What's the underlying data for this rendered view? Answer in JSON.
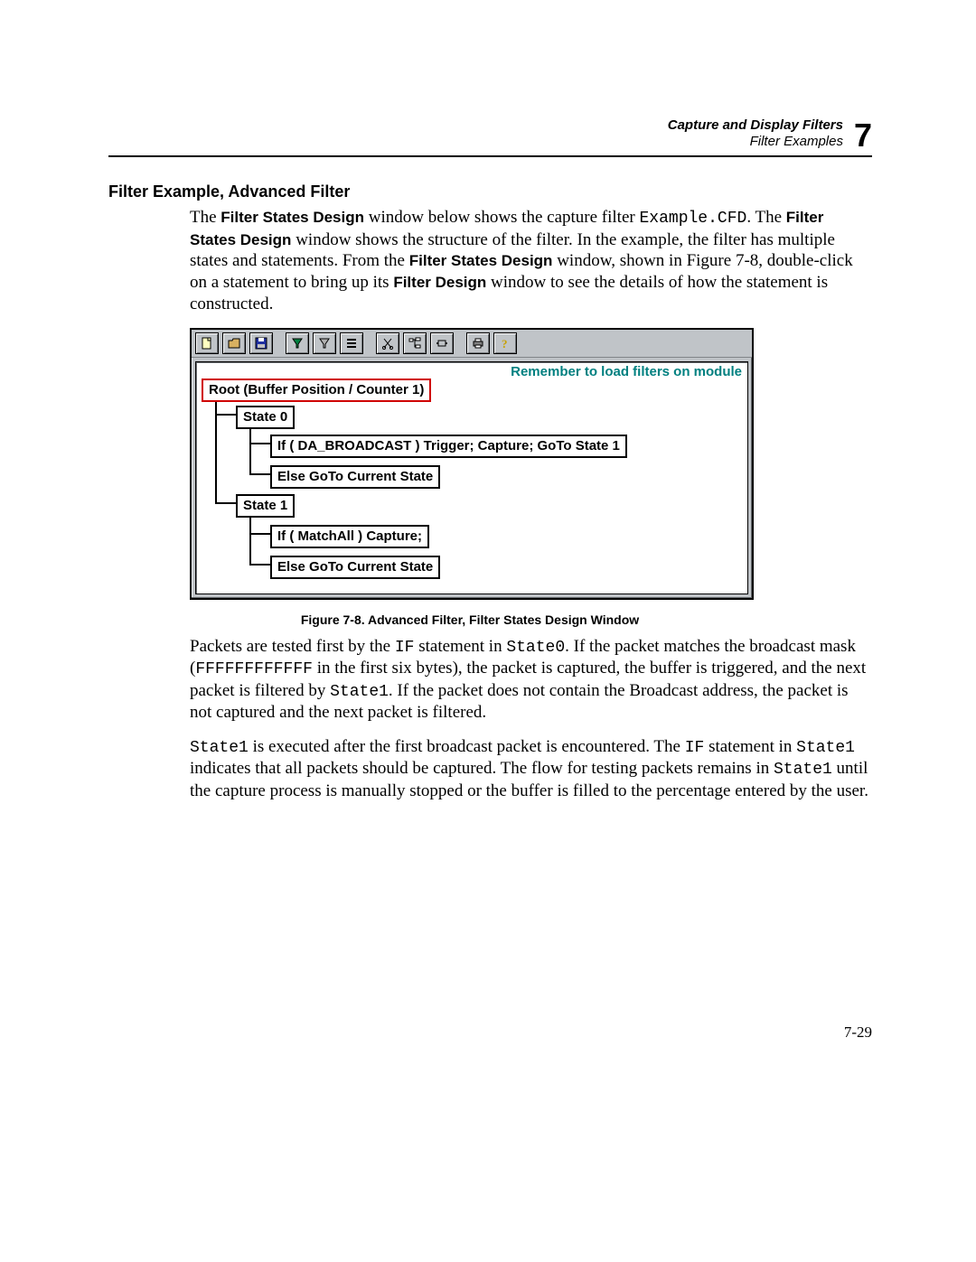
{
  "header": {
    "title": "Capture and Display Filters",
    "subtitle": "Filter Examples",
    "chapter": "7"
  },
  "section_heading": "Filter Example, Advanced Filter",
  "intro": {
    "pre1": "The ",
    "fsd1": "Filter States Design",
    "mid1": " window below shows the capture filter ",
    "code1": "Example.CFD",
    "post1": ". The ",
    "fsd2": "Filter States Design",
    "mid2": " window shows the structure of the filter. In the example, the filter has multiple states and statements. From the ",
    "fsd3": "Filter States Design",
    "mid3": " window, shown in Figure 7-8, double-click on a statement to bring up its ",
    "fd": "Filter Design",
    "post3": " window to see the details of how the statement is constructed."
  },
  "figure": {
    "reminder": "Remember to load filters on module",
    "root": "Root (Buffer Position / Counter 1)",
    "state0": "State 0",
    "s0_if": "If ( DA_BROADCAST )  Trigger;  Capture; GoTo State 1",
    "s0_else": "Else GoTo Current State",
    "state1": "State 1",
    "s1_if": "If ( MatchAll )  Capture;",
    "s1_else": "Else GoTo Current State",
    "caption": "Figure 7-8. Advanced Filter, Filter States Design Window"
  },
  "para2": {
    "t1": "Packets are tested first by the ",
    "c1": "IF",
    "t2": " statement in ",
    "c2": "State0",
    "t3": ". If the packet matches the broadcast mask (",
    "c3": "FFFFFFFFFFFF",
    "t4": " in the first six bytes), the packet is captured, the buffer is triggered, and the next packet is filtered by ",
    "c4": "State1",
    "t5": ". If the packet does not contain the Broadcast address, the packet is not captured and the next packet is filtered."
  },
  "para3": {
    "c1": "State1",
    "t1": " is executed after the first broadcast packet is encountered. The ",
    "c2": "IF",
    "t2": " statement in ",
    "c3": "State1",
    "t3": " indicates that all packets should be captured. The flow for testing packets remains in ",
    "c4": "State1",
    "t4": " until the capture process is manually stopped or the buffer is filled to the percentage entered by the user."
  },
  "page_number": "7-29"
}
